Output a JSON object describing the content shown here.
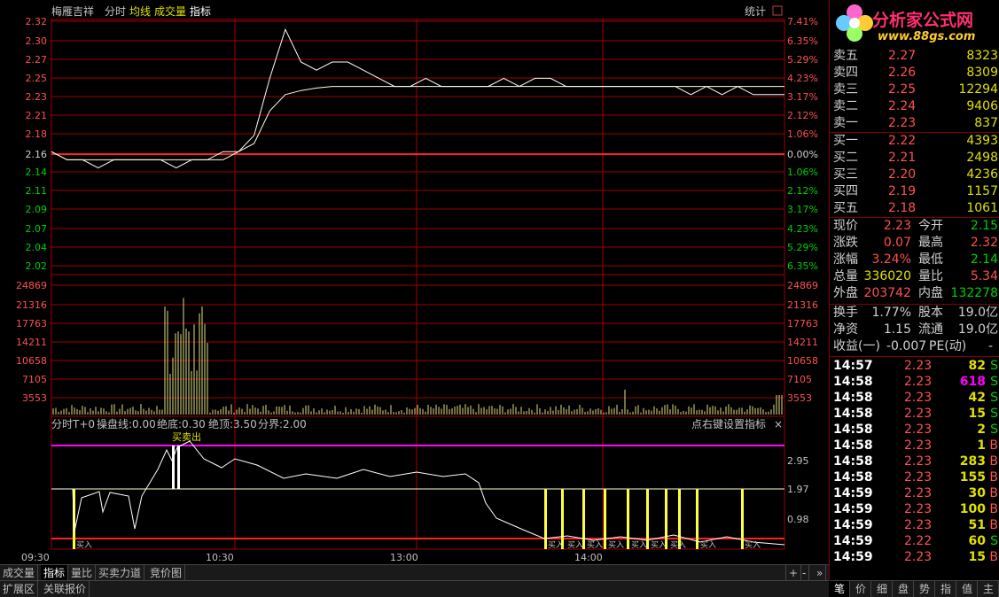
{
  "header": {
    "stock_name": "梅雁吉祥",
    "menu": [
      "分时",
      "均线",
      "成交量",
      "指标"
    ],
    "stats_label": "统计"
  },
  "price_axis": {
    "left": [
      "2.32",
      "2.30",
      "2.27",
      "2.25",
      "2.23",
      "2.21",
      "2.18",
      "2.16",
      "2.14",
      "2.11",
      "2.09",
      "2.07",
      "2.04",
      "2.02"
    ],
    "right": [
      "7.41%",
      "6.35%",
      "5.29%",
      "4.23%",
      "3.17%",
      "2.12%",
      "1.06%",
      "0.00%",
      "1.06%",
      "2.12%",
      "3.17%",
      "4.23%",
      "5.29%",
      "6.35%"
    ]
  },
  "volume_axis": [
    "24869",
    "21316",
    "17763",
    "14211",
    "10658",
    "7105",
    "3553"
  ],
  "indicator": {
    "title": "分时T+0",
    "params": [
      "操盘线:0.00",
      "绝底:0.30",
      "绝顶:3.50",
      "分界:2.00"
    ],
    "settings_text": "点右键设置指标",
    "close_glyph": "×",
    "axis": [
      "2.95",
      "1.97",
      "0.98"
    ],
    "signal_label": "买卖出",
    "buy_marks": [
      "买入",
      "买入",
      "买入",
      "买入",
      "买入",
      "买入",
      "买入",
      "买入",
      "买入",
      "买入"
    ]
  },
  "time_axis": [
    "09:30",
    "10:30",
    "13:00",
    "14:00"
  ],
  "bottom_tabs": [
    "成交量",
    "指标",
    "量比",
    "买卖力道",
    "竞价图"
  ],
  "bottom_tabs_active": 1,
  "bottom_controls": [
    "+",
    "-",
    "»"
  ],
  "footer_tabs": [
    "扩展区",
    "关联报价"
  ],
  "logo": {
    "title": "分析家公式网",
    "url": "www.88gs.com"
  },
  "order_book": {
    "asks": [
      {
        "label": "卖五",
        "price": "2.27",
        "vol": "8323"
      },
      {
        "label": "卖四",
        "price": "2.26",
        "vol": "8309"
      },
      {
        "label": "卖三",
        "price": "2.25",
        "vol": "12294"
      },
      {
        "label": "卖二",
        "price": "2.24",
        "vol": "9406"
      },
      {
        "label": "卖一",
        "price": "2.23",
        "vol": "837"
      }
    ],
    "bids": [
      {
        "label": "买一",
        "price": "2.22",
        "vol": "4393"
      },
      {
        "label": "买二",
        "price": "2.21",
        "vol": "2498"
      },
      {
        "label": "买三",
        "price": "2.20",
        "vol": "4236"
      },
      {
        "label": "买四",
        "price": "2.19",
        "vol": "1157"
      },
      {
        "label": "买五",
        "price": "2.18",
        "vol": "1061"
      }
    ]
  },
  "stats": [
    {
      "l1": "现价",
      "v1": "2.23",
      "c1": "#ff5050",
      "l2": "今开",
      "v2": "2.15",
      "c2": "#00d000"
    },
    {
      "l1": "涨跌",
      "v1": "0.07",
      "c1": "#ff5050",
      "l2": "最高",
      "v2": "2.32",
      "c2": "#ff5050"
    },
    {
      "l1": "涨幅",
      "v1": "3.24%",
      "c1": "#ff5050",
      "l2": "最低",
      "v2": "2.14",
      "c2": "#00d000"
    },
    {
      "l1": "总量",
      "v1": "336020",
      "c1": "#e0e000",
      "l2": "量比",
      "v2": "5.34",
      "c2": "#ff5050"
    },
    {
      "l1": "外盘",
      "v1": "203742",
      "c1": "#ff5050",
      "l2": "内盘",
      "v2": "132278",
      "c2": "#00d000"
    },
    {
      "l1": "换手",
      "v1": "1.77%",
      "c1": "#d0d0d0",
      "l2": "股本",
      "v2": "19.0亿",
      "c2": "#d0d0d0"
    },
    {
      "l1": "净资",
      "v1": "1.15",
      "c1": "#d0d0d0",
      "l2": "流通",
      "v2": "19.0亿",
      "c2": "#d0d0d0"
    }
  ],
  "earnings": {
    "label": "收益(一)",
    "value": "-0.007",
    "pe_label": "PE(动)",
    "pe_value": "-"
  },
  "trades": [
    {
      "time": "14:57",
      "price": "2.23",
      "vol": "82",
      "side": "S",
      "vc": "#e0e000"
    },
    {
      "time": "14:58",
      "price": "2.23",
      "vol": "618",
      "side": "S",
      "vc": "#ff00ff"
    },
    {
      "time": "14:58",
      "price": "2.23",
      "vol": "42",
      "side": "S",
      "vc": "#e0e000"
    },
    {
      "time": "14:58",
      "price": "2.23",
      "vol": "15",
      "side": "S",
      "vc": "#e0e000"
    },
    {
      "time": "14:58",
      "price": "2.23",
      "vol": "2",
      "side": "S",
      "vc": "#e0e000"
    },
    {
      "time": "14:58",
      "price": "2.23",
      "vol": "1",
      "side": "B",
      "vc": "#e0e000"
    },
    {
      "time": "14:58",
      "price": "2.23",
      "vol": "283",
      "side": "B",
      "vc": "#e0e000"
    },
    {
      "time": "14:58",
      "price": "2.23",
      "vol": "155",
      "side": "B",
      "vc": "#e0e000"
    },
    {
      "time": "14:59",
      "price": "2.23",
      "vol": "30",
      "side": "B",
      "vc": "#e0e000"
    },
    {
      "time": "14:59",
      "price": "2.23",
      "vol": "100",
      "side": "B",
      "vc": "#e0e000"
    },
    {
      "time": "14:59",
      "price": "2.23",
      "vol": "51",
      "side": "B",
      "vc": "#e0e000"
    },
    {
      "time": "14:59",
      "price": "2.22",
      "vol": "60",
      "side": "S",
      "vc": "#e0e000"
    },
    {
      "time": "14:59",
      "price": "2.23",
      "vol": "15",
      "side": "B",
      "vc": "#e0e000"
    }
  ],
  "right_tabs": [
    "笔",
    "价",
    "细",
    "盘",
    "势",
    "指",
    "值",
    "主"
  ],
  "right_tabs_active": 0,
  "chart_data": {
    "type": "line",
    "prev_close": 2.16,
    "price_range": [
      2.02,
      2.32
    ],
    "price_series_sample": [
      2.16,
      2.15,
      2.15,
      2.14,
      2.15,
      2.15,
      2.15,
      2.15,
      2.14,
      2.15,
      2.15,
      2.16,
      2.16,
      2.18,
      2.25,
      2.31,
      2.27,
      2.26,
      2.27,
      2.27,
      2.26,
      2.25,
      2.24,
      2.24,
      2.25,
      2.24,
      2.24,
      2.24,
      2.24,
      2.25,
      2.24,
      2.25,
      2.25,
      2.24,
      2.24,
      2.24,
      2.24,
      2.24,
      2.24,
      2.24,
      2.24,
      2.23,
      2.24,
      2.23,
      2.24,
      2.23,
      2.23,
      2.23
    ],
    "avg_series_sample": [
      2.16,
      2.15,
      2.15,
      2.15,
      2.15,
      2.15,
      2.15,
      2.15,
      2.15,
      2.15,
      2.15,
      2.15,
      2.16,
      2.17,
      2.21,
      2.23,
      2.235,
      2.238,
      2.24,
      2.24,
      2.24,
      2.24,
      2.24,
      2.24,
      2.24,
      2.24,
      2.24,
      2.24,
      2.24,
      2.24,
      2.24,
      2.24,
      2.24,
      2.24,
      2.24,
      2.24,
      2.24,
      2.24,
      2.24,
      2.24,
      2.24,
      2.24,
      2.24,
      2.24,
      2.24,
      2.24,
      2.24,
      2.24
    ]
  }
}
